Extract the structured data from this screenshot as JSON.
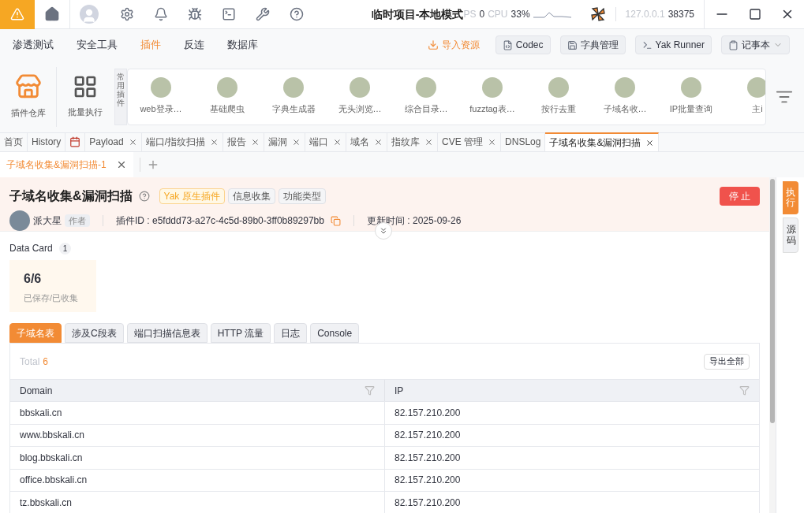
{
  "title_bar": {
    "project": "临时项目-本地模式",
    "ps_label": "PS",
    "ps_value": "0",
    "cpu_label": "CPU",
    "cpu_value": "33%",
    "host": "127.0.0.1",
    "port": "38375"
  },
  "nav": [
    {
      "label": "渗透测试",
      "selected": false
    },
    {
      "label": "安全工具",
      "selected": false
    },
    {
      "label": "插件",
      "selected": true
    },
    {
      "label": "反连",
      "selected": false
    },
    {
      "label": "数据库",
      "selected": false
    }
  ],
  "toolbar": {
    "import": "导入资源",
    "buttons": [
      {
        "label": "Codec",
        "kind": "codec"
      },
      {
        "label": "字典管理",
        "kind": "dict"
      },
      {
        "label": "Yak Runner",
        "kind": "runner"
      },
      {
        "label": "记事本",
        "kind": "notepad"
      }
    ]
  },
  "plugin_shortcuts": [
    {
      "label": "插件仓库",
      "kind": "store"
    },
    {
      "label": "批量执行",
      "kind": "batch"
    }
  ],
  "common_label": "常用插件",
  "common_plugins": [
    "web登录…",
    "基础爬虫",
    "字典生成器",
    "无头浏览…",
    "综合目录…",
    "fuzztag表…",
    "按行去重",
    "子域名收…",
    "IP批量查询",
    "主i"
  ],
  "page_tabs": [
    {
      "label": "首页",
      "kind": "text",
      "closable": false,
      "selected": false
    },
    {
      "label": "History",
      "kind": "text",
      "closable": false,
      "selected": false
    },
    {
      "kind": "icon",
      "closable": false,
      "selected": false
    },
    {
      "label": "Payload",
      "kind": "text",
      "closable": true,
      "selected": false
    },
    {
      "label": "端口/指纹扫描",
      "kind": "text",
      "closable": true,
      "selected": false
    },
    {
      "label": "报告",
      "kind": "text",
      "closable": true,
      "selected": false
    },
    {
      "label": "漏洞",
      "kind": "text",
      "closable": true,
      "selected": false
    },
    {
      "label": "端口",
      "kind": "text",
      "closable": true,
      "selected": false
    },
    {
      "label": "域名",
      "kind": "text",
      "closable": true,
      "selected": false
    },
    {
      "label": "指纹库",
      "kind": "text",
      "closable": true,
      "selected": false
    },
    {
      "label": "CVE 管理",
      "kind": "text",
      "closable": true,
      "selected": false
    },
    {
      "label": "DNSLog",
      "kind": "text",
      "closable": false,
      "selected": false
    },
    {
      "label": "子域名收集&漏洞扫描",
      "kind": "text",
      "closable": true,
      "selected": true
    }
  ],
  "sub_tab": {
    "label": "子域名收集&漏洞扫描-1"
  },
  "plugin": {
    "name": "子域名收集&漏洞扫描",
    "tags": [
      {
        "label": "Yak 原生插件",
        "kind": "primary"
      },
      {
        "label": "信息收集",
        "kind": "plain"
      },
      {
        "label": "功能类型",
        "kind": "plain"
      }
    ],
    "stop": "停 止",
    "author": "派大星",
    "author_role": "作者",
    "id": "插件ID : e5fddd73-a27c-4c5d-89b0-3ff0b89297bb",
    "updated": "更新时间 : 2025-09-26"
  },
  "side_tabs": [
    {
      "label": "执行",
      "selected": true
    },
    {
      "label": "源码",
      "selected": false
    }
  ],
  "data_card": {
    "title": "Data Card",
    "count": "1",
    "value": "6/6",
    "caption": "已保存/已收集"
  },
  "result_tabs": [
    {
      "label": "子域名表",
      "selected": true
    },
    {
      "label": "涉及C段表",
      "selected": false
    },
    {
      "label": "端口扫描信息表",
      "selected": false
    },
    {
      "label": "HTTP 流量",
      "selected": false
    },
    {
      "label": "日志",
      "selected": false
    },
    {
      "label": "Console",
      "selected": false
    }
  ],
  "table": {
    "total_label": "Total",
    "total": "6",
    "export": "导出全部",
    "columns": [
      "Domain",
      "IP"
    ],
    "rows": [
      [
        "bbskali.cn",
        "82.157.210.200"
      ],
      [
        "www.bbskali.cn",
        "82.157.210.200"
      ],
      [
        "blog.bbskali.cn",
        "82.157.210.200"
      ],
      [
        "office.bbskali.cn",
        "82.157.210.200"
      ],
      [
        "tz.bbskali.cn",
        "82.157.210.200"
      ]
    ]
  }
}
